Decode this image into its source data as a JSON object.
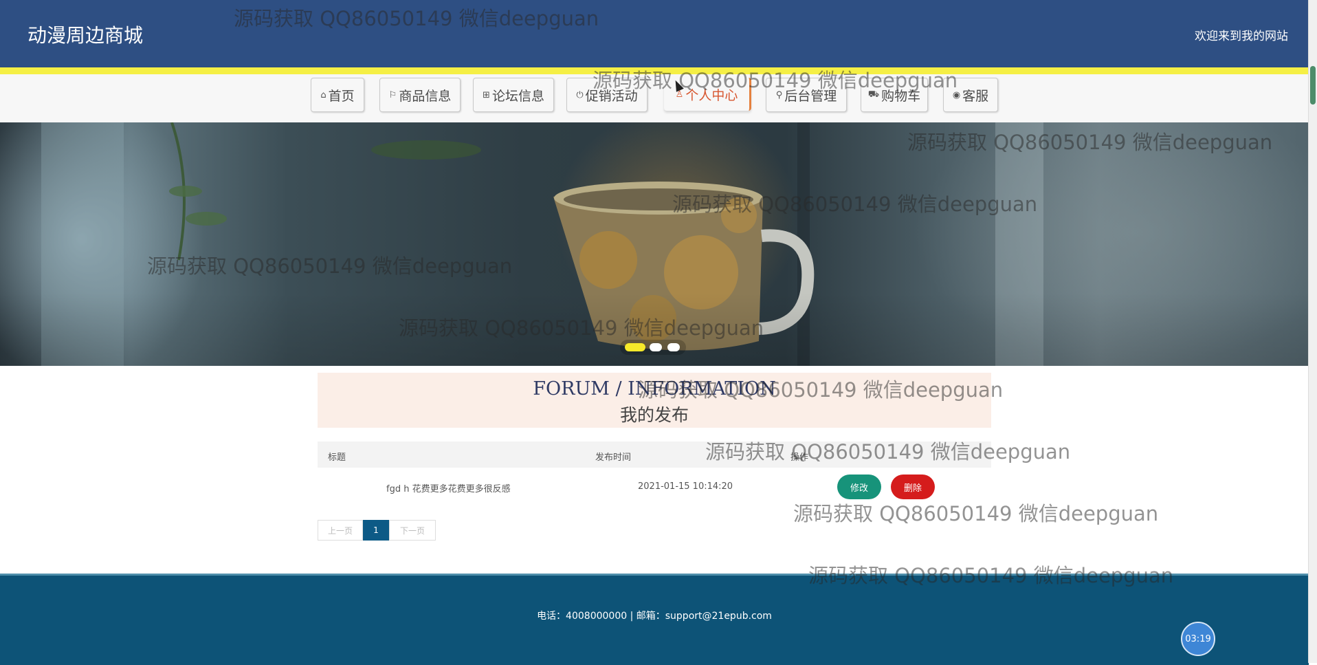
{
  "header": {
    "brand": "动漫周边商城",
    "welcome": "欢迎来到我的网站"
  },
  "nav": {
    "items": [
      {
        "label": "首页",
        "icon": "home-icon"
      },
      {
        "label": "商品信息",
        "icon": "flag-icon"
      },
      {
        "label": "论坛信息",
        "icon": "forum-icon"
      },
      {
        "label": "促销活动",
        "icon": "power-icon"
      },
      {
        "label": "个人中心",
        "icon": "user-icon",
        "active": true
      },
      {
        "label": "后台管理",
        "icon": "link-icon"
      },
      {
        "label": "购物车",
        "icon": "cart-icon"
      },
      {
        "label": "客服",
        "icon": "support-icon"
      }
    ]
  },
  "banner": {
    "slides": 3,
    "active_slide": 1
  },
  "section": {
    "title_en": "FORUM / INFORMATION",
    "title_cn": "我的发布"
  },
  "table": {
    "columns": [
      "标题",
      "发布时间",
      "操作"
    ],
    "rows": [
      {
        "title": "fgd h 花费更多花费更多很反感",
        "time": "2021-01-15 10:14:20",
        "edit": "修改",
        "delete": "删除"
      }
    ]
  },
  "pagination": {
    "prev": "上一页",
    "current": "1",
    "next": "下一页"
  },
  "footer": {
    "contact": "电话：4008000000 | 邮箱：support@21epub.com"
  },
  "timer": "03:19",
  "watermark": "源码获取 QQ86050149 微信deepguan",
  "colors": {
    "header": "#2e4f83",
    "accent_line": "#f5ef45",
    "footer": "#0d5377",
    "edit": "#17937a",
    "delete": "#d51c1c"
  }
}
